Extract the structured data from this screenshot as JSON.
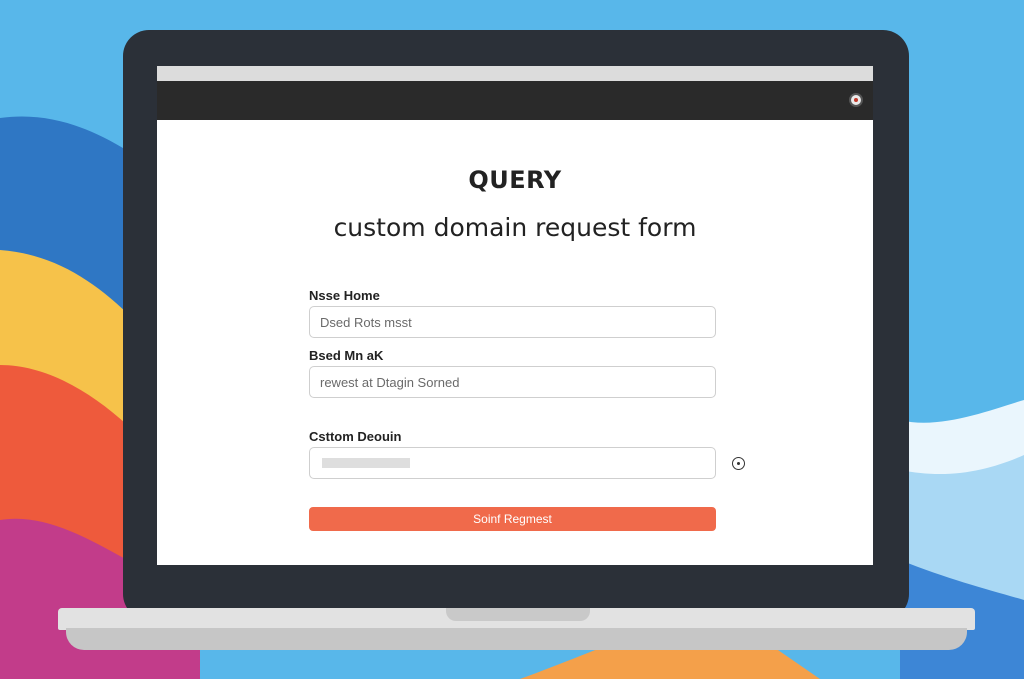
{
  "colors": {
    "accent": "#f06a4b",
    "app_bar": "#2a2a2a",
    "laptop_bezel": "#2b3038"
  },
  "header": {
    "title": "QUERY",
    "subtitle": "custom domain request form",
    "avatar_icon": "user-avatar-icon"
  },
  "form": {
    "field1": {
      "label": "Nsse Home",
      "placeholder": "Dsed Rots msst"
    },
    "field2": {
      "label": "Bsed Mn aK",
      "placeholder": "rewest at Dtagin Sorned"
    },
    "field3": {
      "label": "Csttom Deouin",
      "help_icon": "info-icon"
    },
    "submit_label": "Soinf Regmest"
  }
}
